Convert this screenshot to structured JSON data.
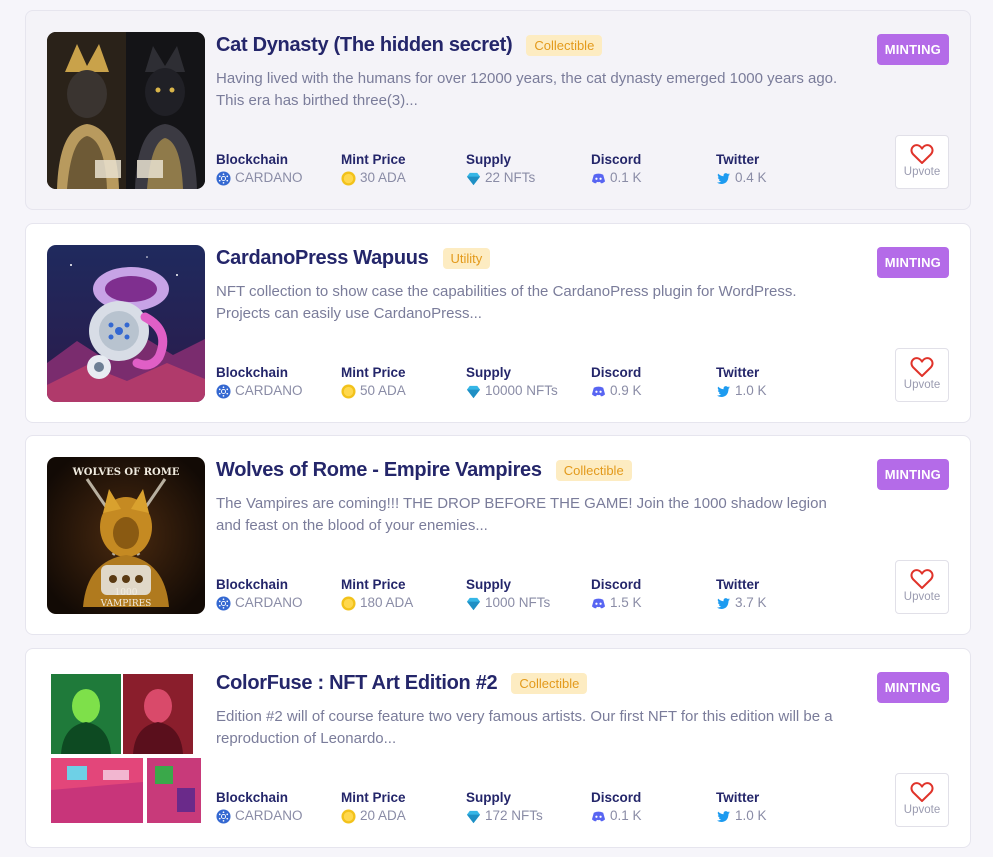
{
  "listings": [
    {
      "title": "Cat Dynasty (The hidden secret)",
      "category": "Collectible",
      "description": "Having lived with the humans for over 12000 years, the cat dynasty emerged 1000 years ago. This era has birthed three(3)...",
      "status": "MINTING",
      "stats": [
        {
          "label": "Blockchain",
          "value": "CARDANO",
          "icon": "cardano-icon"
        },
        {
          "label": "Mint Price",
          "value": "30 ADA",
          "icon": "coin-icon"
        },
        {
          "label": "Supply",
          "value": "22 NFTs",
          "icon": "diamond-icon"
        },
        {
          "label": "Discord",
          "value": "0.1 K",
          "icon": "discord-icon"
        },
        {
          "label": "Twitter",
          "value": "0.4 K",
          "icon": "twitter-icon"
        }
      ],
      "upvote_label": "Upvote"
    },
    {
      "title": "CardanoPress Wapuus",
      "category": "Utility",
      "description": "NFT collection to show case the capabilities of the CardanoPress plugin for WordPress. Projects can easily use CardanoPress...",
      "status": "MINTING",
      "stats": [
        {
          "label": "Blockchain",
          "value": "CARDANO",
          "icon": "cardano-icon"
        },
        {
          "label": "Mint Price",
          "value": "50 ADA",
          "icon": "coin-icon"
        },
        {
          "label": "Supply",
          "value": "10000 NFTs",
          "icon": "diamond-icon"
        },
        {
          "label": "Discord",
          "value": "0.9 K",
          "icon": "discord-icon"
        },
        {
          "label": "Twitter",
          "value": "1.0 K",
          "icon": "twitter-icon"
        }
      ],
      "upvote_label": "Upvote"
    },
    {
      "title": "Wolves of Rome - Empire Vampires",
      "category": "Collectible",
      "description": "The Vampires are coming!!! THE DROP BEFORE THE GAME! Join the 1000 shadow legion and feast on the blood of your enemies...",
      "status": "MINTING",
      "image_text": {
        "top": "WOLVES OF ROME",
        "bottom_1": "1000",
        "bottom_2": "VAMPIRES"
      },
      "stats": [
        {
          "label": "Blockchain",
          "value": "CARDANO",
          "icon": "cardano-icon"
        },
        {
          "label": "Mint Price",
          "value": "180 ADA",
          "icon": "coin-icon"
        },
        {
          "label": "Supply",
          "value": "1000 NFTs",
          "icon": "diamond-icon"
        },
        {
          "label": "Discord",
          "value": "1.5 K",
          "icon": "discord-icon"
        },
        {
          "label": "Twitter",
          "value": "3.7 K",
          "icon": "twitter-icon"
        }
      ],
      "upvote_label": "Upvote"
    },
    {
      "title": "ColorFuse : NFT Art Edition #2",
      "category": "Collectible",
      "description": "Edition #2 will of course feature two very famous artists. Our first NFT for this edition will be a reproduction of Leonardo...",
      "status": "MINTING",
      "stats": [
        {
          "label": "Blockchain",
          "value": "CARDANO",
          "icon": "cardano-icon"
        },
        {
          "label": "Mint Price",
          "value": "20 ADA",
          "icon": "coin-icon"
        },
        {
          "label": "Supply",
          "value": "172 NFTs",
          "icon": "diamond-icon"
        },
        {
          "label": "Discord",
          "value": "0.1 K",
          "icon": "discord-icon"
        },
        {
          "label": "Twitter",
          "value": "1.0 K",
          "icon": "twitter-icon"
        }
      ],
      "upvote_label": "Upvote"
    }
  ],
  "colors": {
    "title": "#24266a",
    "tag_bg": "#fdecc2",
    "tag_text": "#e39a1c",
    "minting_bg": "#b46be8",
    "heart": "#e0332a",
    "cardano": "#3468d1",
    "coin": "#f2c21b",
    "diamond": "#36b6e6",
    "discord": "#5865f2",
    "twitter": "#1d9bf0"
  }
}
